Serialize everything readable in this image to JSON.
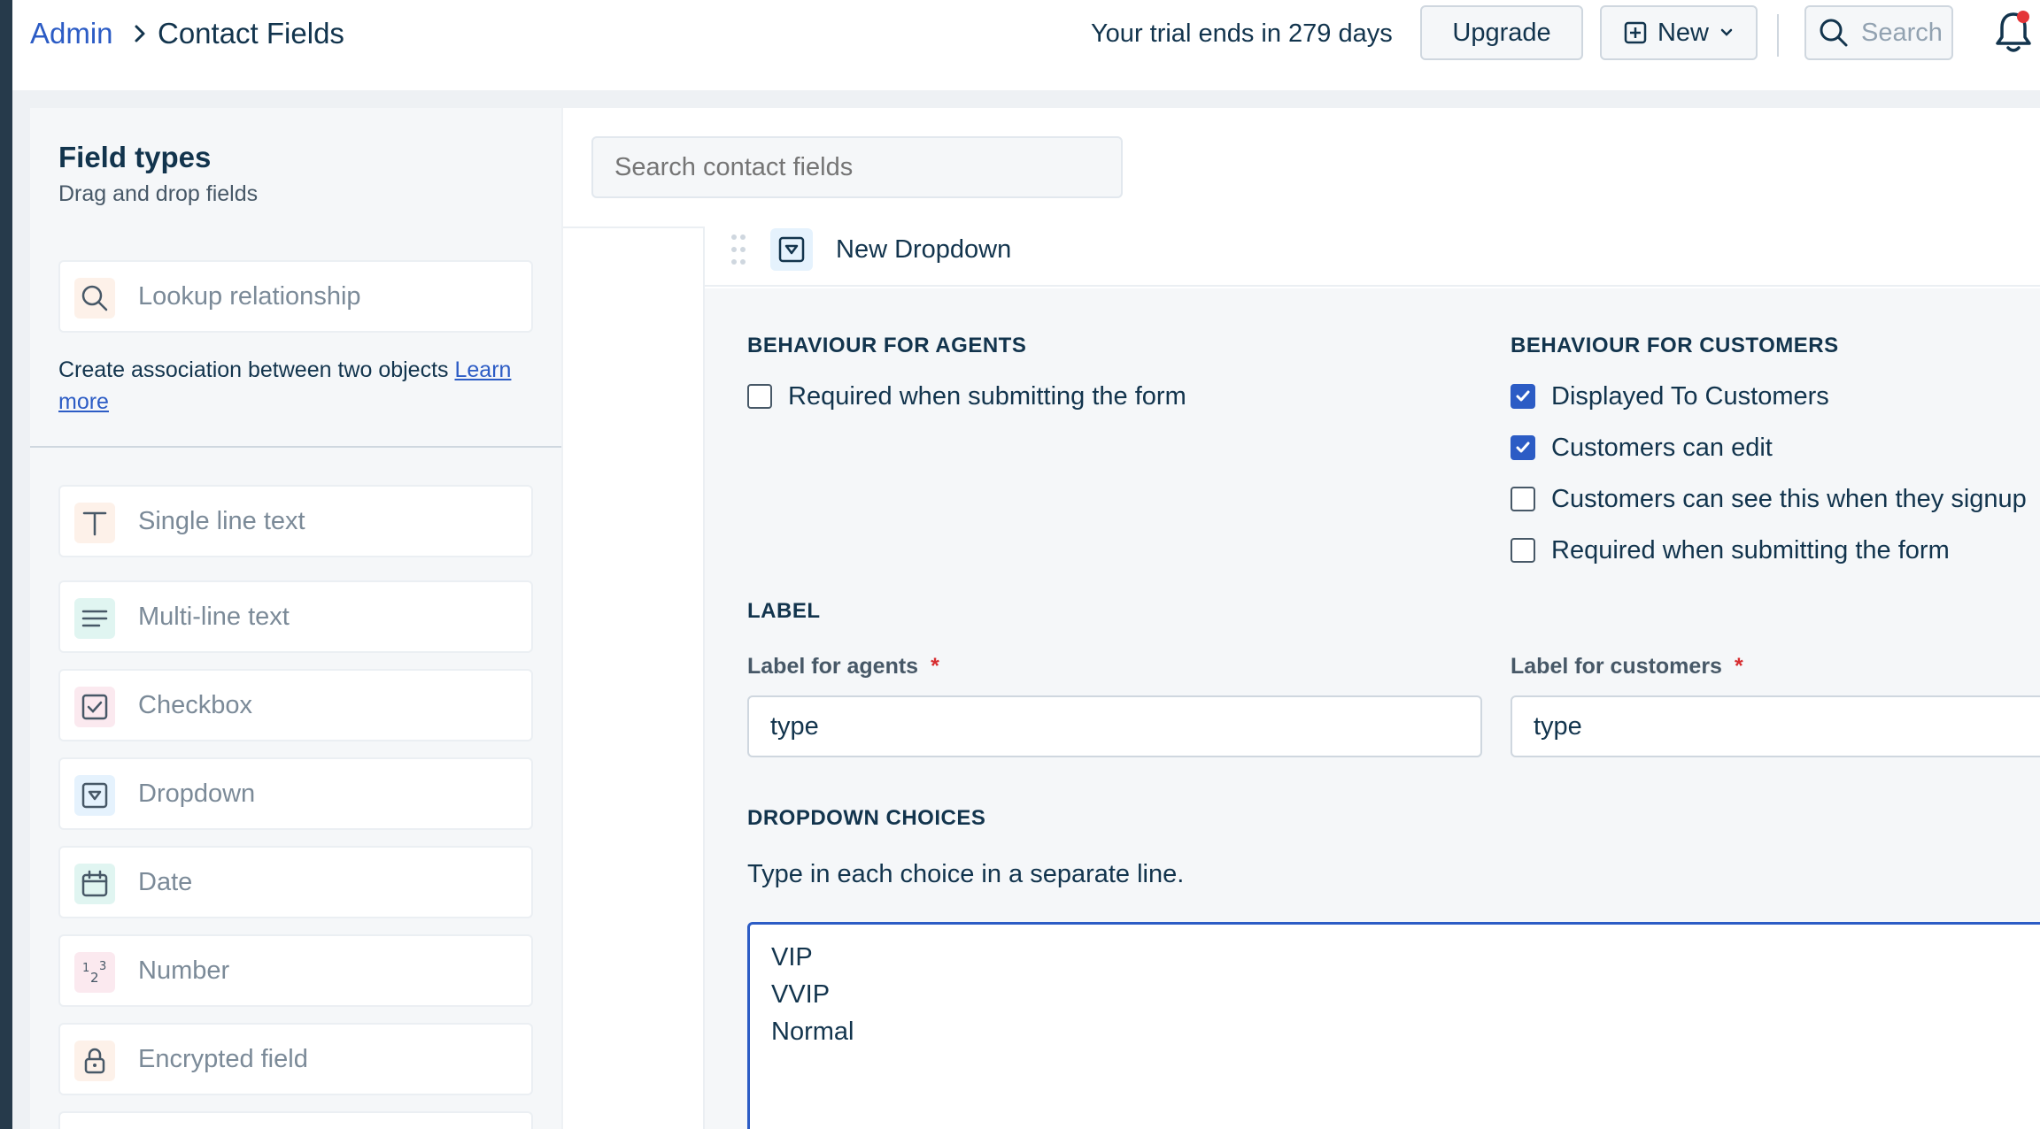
{
  "header": {
    "breadcrumb_parent": "Admin",
    "breadcrumb_current": "Contact Fields",
    "trial_text": "Your trial ends in 279 days",
    "upgrade_label": "Upgrade",
    "new_label": "New",
    "search_label": "Search"
  },
  "sidebar": {
    "title": "Field types",
    "subtitle": "Drag and drop fields",
    "lookup_label": "Lookup relationship",
    "association_text": "Create association between two objects ",
    "learn_more": "Learn more",
    "items": [
      {
        "label": "Single line text",
        "icon": "text-icon"
      },
      {
        "label": "Multi-line text",
        "icon": "paragraph-icon"
      },
      {
        "label": "Checkbox",
        "icon": "checkbox-icon"
      },
      {
        "label": "Dropdown",
        "icon": "dropdown-icon"
      },
      {
        "label": "Date",
        "icon": "calendar-icon"
      },
      {
        "label": "Number",
        "icon": "number-icon"
      },
      {
        "label": "Encrypted field",
        "icon": "lock-icon"
      }
    ]
  },
  "main": {
    "search_placeholder": "Search contact fields",
    "field_title": "New Dropdown",
    "agents": {
      "heading": "BEHAVIOUR FOR AGENTS",
      "options": [
        {
          "label": "Required when submitting the form",
          "checked": false
        }
      ]
    },
    "customers": {
      "heading": "BEHAVIOUR FOR CUSTOMERS",
      "options": [
        {
          "label": "Displayed To Customers",
          "checked": true
        },
        {
          "label": "Customers can edit",
          "checked": true
        },
        {
          "label": "Customers can see this when they signup",
          "checked": false
        },
        {
          "label": "Required when submitting the form",
          "checked": false
        }
      ]
    },
    "label_section": {
      "heading": "LABEL",
      "agents_label": "Label for agents",
      "agents_value": "type",
      "customers_label": "Label for customers",
      "customers_value": "type",
      "required_mark": "*"
    },
    "choices_section": {
      "heading": "DROPDOWN CHOICES",
      "hint": "Type in each choice in a separate line.",
      "choices": [
        "VIP",
        "VVIP",
        "Normal"
      ]
    }
  },
  "colors": {
    "accent": "#2c5cc5",
    "text": "#12344d",
    "muted": "#7b8a98"
  }
}
